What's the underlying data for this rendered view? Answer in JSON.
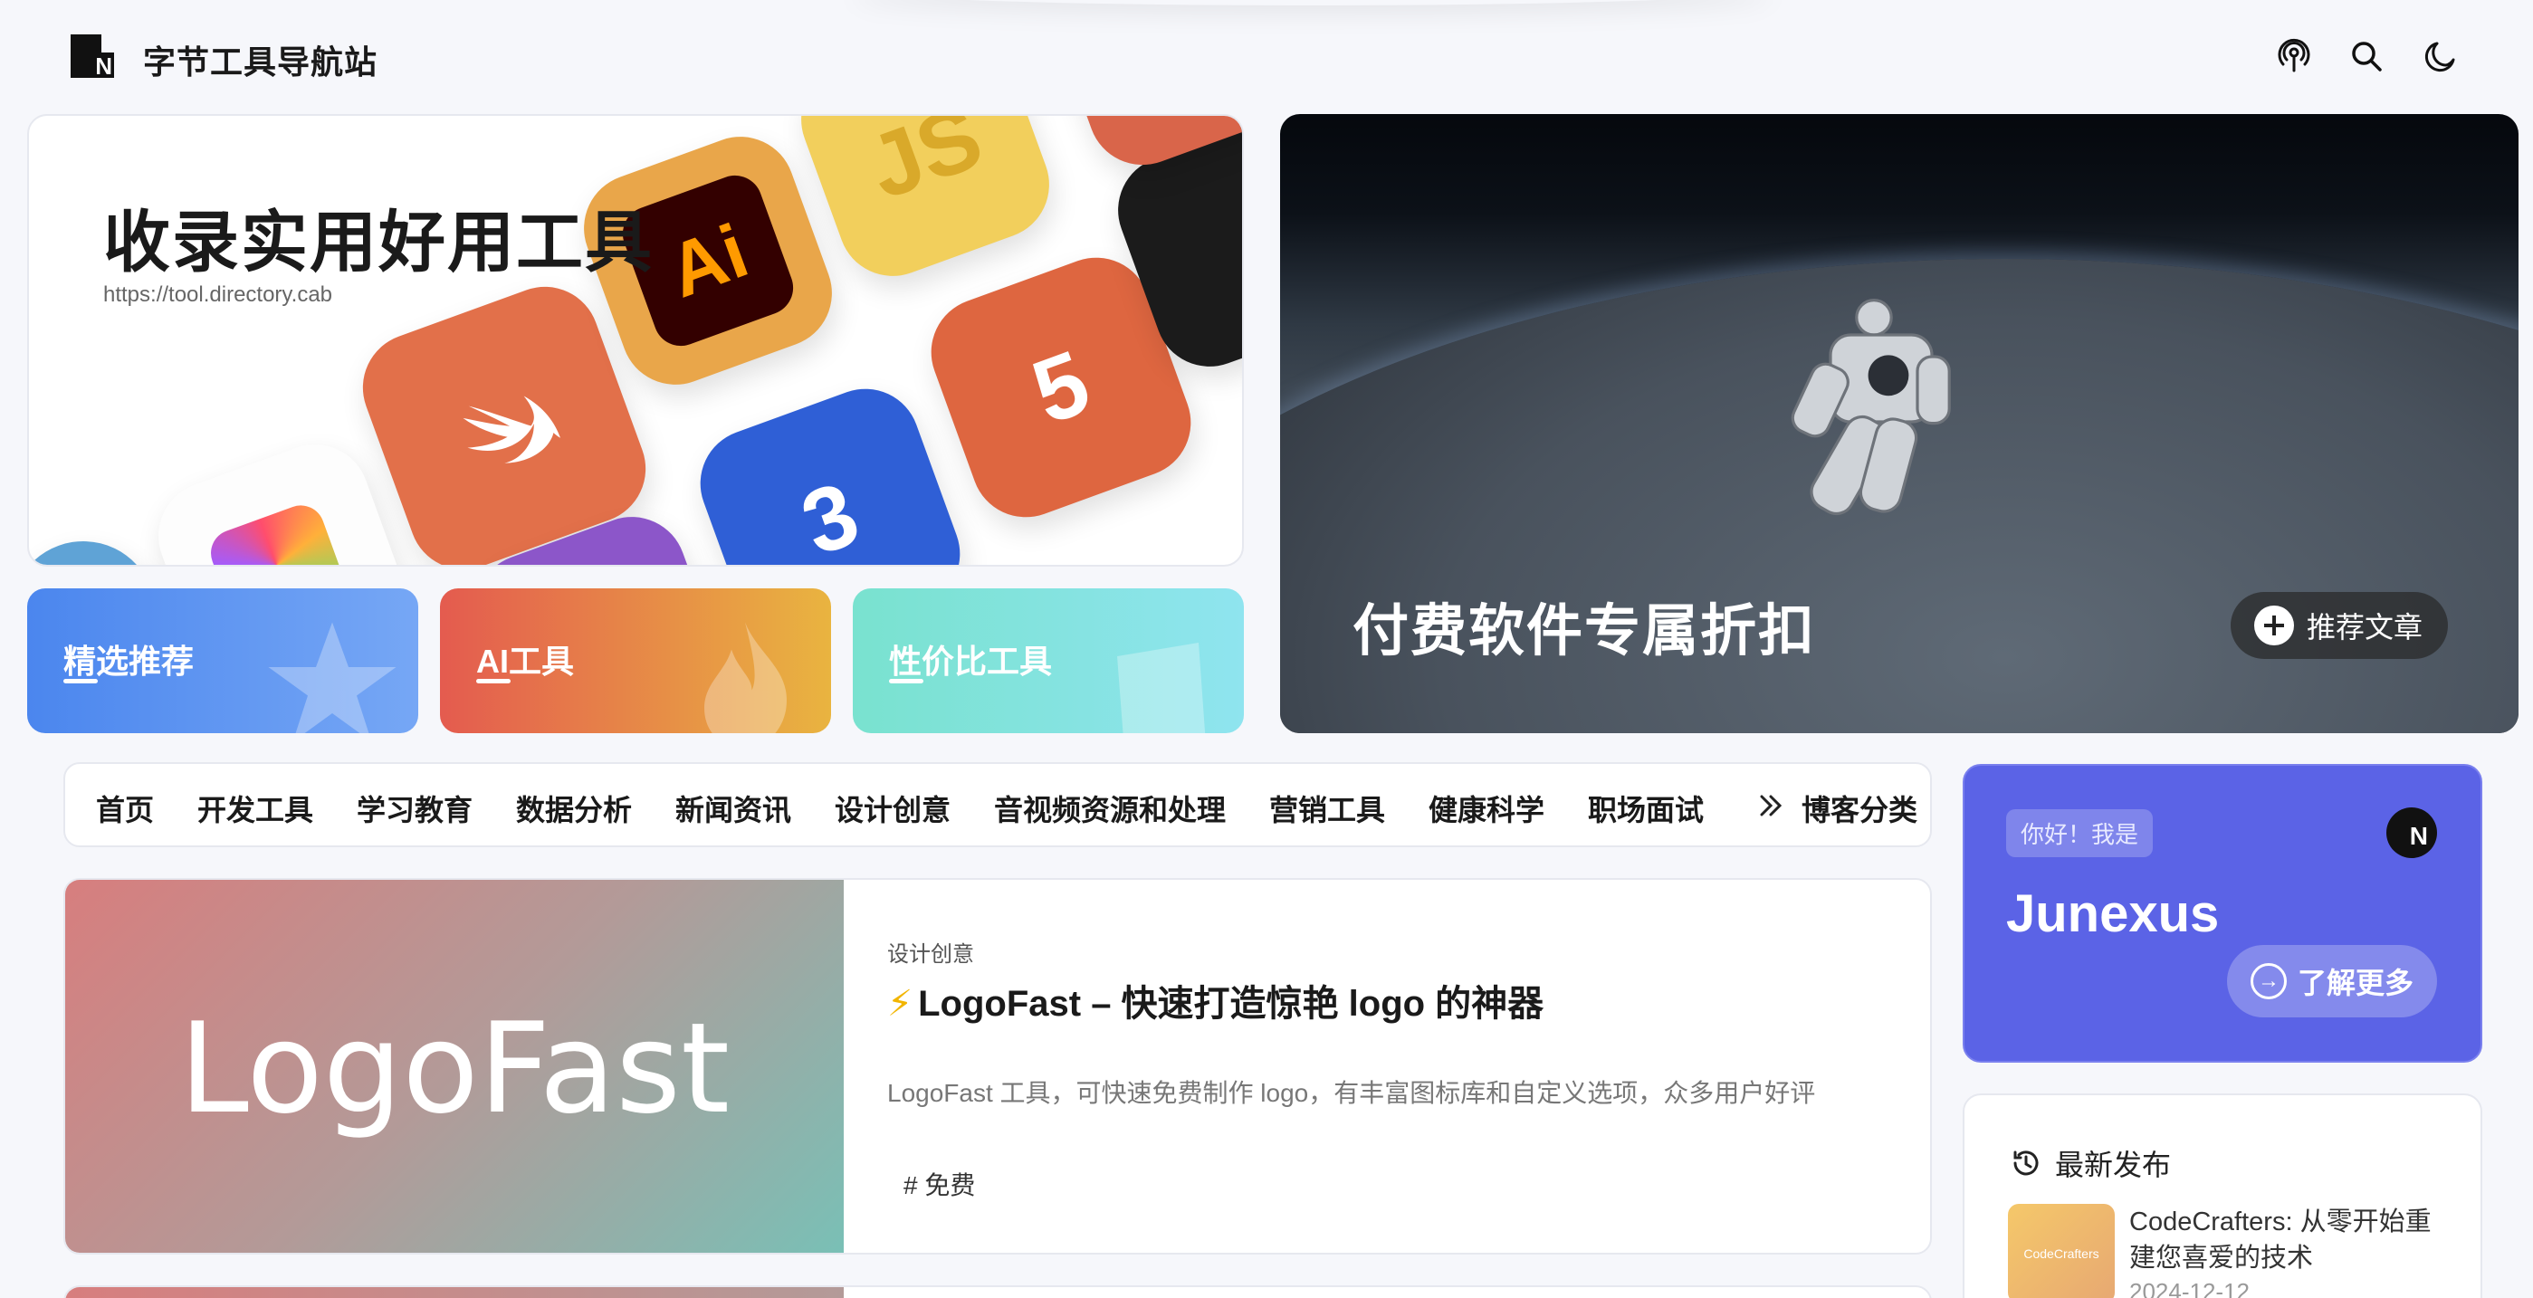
{
  "header": {
    "site_title": "字节工具导航站",
    "icons": [
      "podcast-icon",
      "search-icon",
      "moon-icon"
    ]
  },
  "hero_left": {
    "title": "收录实用好用工具",
    "url": "https://tool.directory.cab",
    "tiles": [
      "swift",
      "adobe-illustrator",
      "javascript",
      "html5",
      "css3",
      "final-cut-pro"
    ]
  },
  "categories": [
    {
      "label": "精选推荐",
      "color_from": "#4b86ee",
      "color_to": "#76a7f5"
    },
    {
      "label": "AI工具",
      "color_from": "#e45b4f",
      "color_to": "#e9b440"
    },
    {
      "label": "性价比工具",
      "color_from": "#79e2cf",
      "color_to": "#8fe4ef"
    }
  ],
  "hero_right": {
    "title": "付费软件专属折扣",
    "button": "推荐文章"
  },
  "nav": {
    "items": [
      "首页",
      "开发工具",
      "学习教育",
      "数据分析",
      "新闻资讯",
      "设计创意",
      "音视频资源和处理",
      "营销工具",
      "健康科学",
      "职场面试"
    ],
    "more_label": "博客分类"
  },
  "article": {
    "thumb_text": "LogoFast",
    "category": "设计创意",
    "emoji": "⚡",
    "title": "LogoFast – 快速打造惊艳 logo 的神器",
    "description": "LogoFast 工具，可快速免费制作 logo，有丰富图标库和自定义选项，众多用户好评",
    "tag": "# 免费"
  },
  "profile": {
    "greeting": "你好！我是",
    "name": "Junexus",
    "avatar_letter": "N",
    "more_button": "了解更多"
  },
  "latest": {
    "heading": "最新发布",
    "post": {
      "thumb_text": "CodeCrafters",
      "title": "CodeCrafters: 从零开始重建您喜爱的技术",
      "date": "2024-12-12"
    }
  },
  "colors": {
    "accent": "#5b63e6",
    "background": "#f6f7fb"
  }
}
